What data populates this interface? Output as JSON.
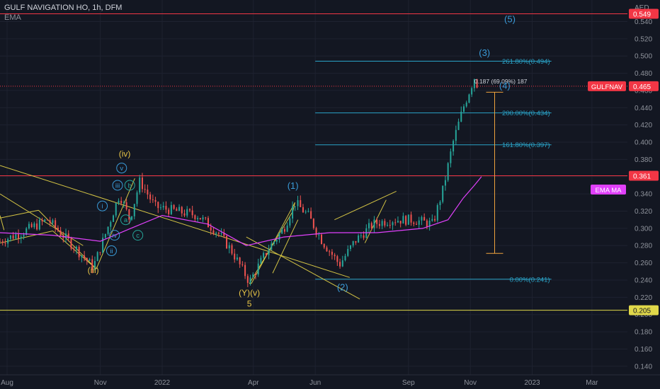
{
  "header": {
    "title": "GULF NAVIGATION HO, 1h, DFM",
    "indicator": "EMA"
  },
  "colors": {
    "background": "#131722",
    "grid": "#1e2230",
    "up": "#26a69a",
    "down": "#ef5350",
    "ema": "#e040fb",
    "trendline": "#d4c444",
    "fib": "#2aa3c7",
    "wave_blue": "#3a9bd8",
    "wave_yellow": "#e8c547",
    "measure": "#f0a33c",
    "red_line": "#f23645",
    "yellow_line": "#e0d84a"
  },
  "chart_data": {
    "type": "candlestick",
    "title": "GULF NAVIGATION HO, 1h, DFM",
    "currency": "AED",
    "ylim": [
      0.13,
      0.565
    ],
    "xlim": [
      "2021-07-25",
      "2023-04-05"
    ],
    "y_ticks": [
      "0.140",
      "0.160",
      "0.180",
      "0.200",
      "0.220",
      "0.240",
      "0.260",
      "0.280",
      "0.300",
      "0.320",
      "0.340",
      "0.360",
      "0.380",
      "0.400",
      "0.420",
      "0.440",
      "0.460",
      "0.480",
      "0.500",
      "0.520",
      "0.540"
    ],
    "x_ticks": [
      {
        "label": "Aug",
        "date": "2021-08-01"
      },
      {
        "label": "Nov",
        "date": "2021-11-01"
      },
      {
        "label": "2022",
        "date": "2022-01-01"
      },
      {
        "label": "Apr",
        "date": "2022-04-01"
      },
      {
        "label": "Jun",
        "date": "2022-06-01"
      },
      {
        "label": "Sep",
        "date": "2022-09-01"
      },
      {
        "label": "Nov",
        "date": "2022-11-01"
      },
      {
        "label": "2023",
        "date": "2023-01-01"
      },
      {
        "label": "Mar",
        "date": "2023-03-01"
      }
    ],
    "price_path": [
      [
        "2021-07-25",
        0.285
      ],
      [
        "2021-08-15",
        0.295
      ],
      [
        "2021-09-10",
        0.31
      ],
      [
        "2021-10-05",
        0.28
      ],
      [
        "2021-10-25",
        0.255
      ],
      [
        "2021-11-08",
        0.3
      ],
      [
        "2021-11-20",
        0.34
      ],
      [
        "2021-11-30",
        0.31
      ],
      [
        "2021-12-10",
        0.355
      ],
      [
        "2021-12-25",
        0.325
      ],
      [
        "2022-01-15",
        0.32
      ],
      [
        "2022-02-05",
        0.315
      ],
      [
        "2022-02-25",
        0.295
      ],
      [
        "2022-03-10",
        0.275
      ],
      [
        "2022-03-28",
        0.238
      ],
      [
        "2022-04-15",
        0.275
      ],
      [
        "2022-05-01",
        0.3
      ],
      [
        "2022-05-12",
        0.33
      ],
      [
        "2022-05-25",
        0.315
      ],
      [
        "2022-06-08",
        0.285
      ],
      [
        "2022-06-25",
        0.258
      ],
      [
        "2022-07-10",
        0.285
      ],
      [
        "2022-07-28",
        0.305
      ],
      [
        "2022-08-15",
        0.31
      ],
      [
        "2022-09-05",
        0.31
      ],
      [
        "2022-09-25",
        0.305
      ],
      [
        "2022-10-05",
        0.345
      ],
      [
        "2022-10-15",
        0.4
      ],
      [
        "2022-10-25",
        0.44
      ],
      [
        "2022-11-05",
        0.475
      ],
      [
        "2022-11-10",
        0.46
      ]
    ],
    "ema_path": [
      [
        "2021-07-25",
        0.295
      ],
      [
        "2021-09-15",
        0.292
      ],
      [
        "2021-11-01",
        0.285
      ],
      [
        "2021-12-01",
        0.3
      ],
      [
        "2022-01-01",
        0.315
      ],
      [
        "2022-02-15",
        0.305
      ],
      [
        "2022-03-25",
        0.28
      ],
      [
        "2022-05-01",
        0.29
      ],
      [
        "2022-06-15",
        0.295
      ],
      [
        "2022-08-01",
        0.295
      ],
      [
        "2022-09-15",
        0.3
      ],
      [
        "2022-10-10",
        0.31
      ],
      [
        "2022-10-25",
        0.335
      ],
      [
        "2022-11-05",
        0.35
      ],
      [
        "2022-11-12",
        0.36
      ]
    ],
    "fib_levels": [
      {
        "label": "261.80%(0.494)",
        "value": 0.494
      },
      {
        "label": "200.00%(0.434)",
        "value": 0.434
      },
      {
        "label": "161.80%(0.397)",
        "value": 0.397
      },
      {
        "label": "0.00%(0.241)",
        "value": 0.241
      }
    ],
    "fib_range": [
      "2022-06-01",
      "2023-01-20"
    ],
    "horizontal_lines": [
      {
        "value": 0.549,
        "label": "0.549",
        "color": "#f23645"
      },
      {
        "value": 0.465,
        "label": "0.465",
        "color": "#f23645",
        "dotted": true,
        "tag": "GULFNAV"
      },
      {
        "value": 0.361,
        "label": "0.361",
        "color": "#f23645",
        "tag": "EMA MA"
      },
      {
        "value": 0.205,
        "label": "0.205",
        "color": "#e0d84a"
      }
    ],
    "measure": {
      "date": "2022-11-25",
      "from": 0.271,
      "to": 0.458,
      "label": "0.187 (69.09%) 187"
    },
    "wave_labels": [
      {
        "text": "(5)",
        "date": "2022-12-10",
        "value": 0.539,
        "color": "#3a9bd8",
        "size": 13
      },
      {
        "text": "(3)",
        "date": "2022-11-15",
        "value": 0.5,
        "color": "#3a9bd8",
        "size": 13
      },
      {
        "text": "(4)",
        "date": "2022-12-05",
        "value": 0.462,
        "color": "#3a9bd8",
        "size": 13
      },
      {
        "text": "(1)",
        "date": "2022-05-10",
        "value": 0.346,
        "color": "#3a9bd8",
        "size": 13
      },
      {
        "text": "(2)",
        "date": "2022-06-28",
        "value": 0.228,
        "color": "#3a9bd8",
        "size": 13
      },
      {
        "text": "(iv)",
        "date": "2021-11-25",
        "value": 0.383,
        "color": "#e8c547",
        "size": 12
      },
      {
        "text": "(iii)",
        "date": "2021-10-25",
        "value": 0.248,
        "color": "#e8c547",
        "size": 12
      },
      {
        "text": "(Y)(v)",
        "date": "2022-03-28",
        "value": 0.222,
        "color": "#e8c547",
        "size": 12
      },
      {
        "text": "5",
        "date": "2022-03-28",
        "value": 0.209,
        "color": "#e8c547",
        "size": 12
      }
    ],
    "circled_labels": [
      {
        "text": "v",
        "date": "2021-11-22",
        "value": 0.37,
        "color": "#3a9bd8"
      },
      {
        "text": "iii",
        "date": "2021-11-18",
        "value": 0.35,
        "color": "#3a9bd8"
      },
      {
        "text": "b",
        "date": "2021-11-30",
        "value": 0.35,
        "color": "#26a69a"
      },
      {
        "text": "i",
        "date": "2021-11-03",
        "value": 0.326,
        "color": "#3a9bd8"
      },
      {
        "text": "a",
        "date": "2021-11-26",
        "value": 0.31,
        "color": "#26a69a"
      },
      {
        "text": "iv",
        "date": "2021-11-15",
        "value": 0.292,
        "color": "#3a9bd8"
      },
      {
        "text": "c",
        "date": "2021-12-08",
        "value": 0.292,
        "color": "#26a69a"
      },
      {
        "text": "ii",
        "date": "2021-11-12",
        "value": 0.274,
        "color": "#3a9bd8"
      }
    ],
    "trendlines": [
      [
        [
          "2021-07-25",
          0.373
        ],
        [
          "2022-07-05",
          0.243
        ]
      ],
      [
        [
          "2021-07-25",
          0.34
        ],
        [
          "2021-10-15",
          0.28
        ]
      ],
      [
        [
          "2021-07-25",
          0.312
        ],
        [
          "2021-09-01",
          0.321
        ]
      ],
      [
        [
          "2021-07-25",
          0.283
        ],
        [
          "2021-09-15",
          0.297
        ]
      ],
      [
        [
          "2021-09-01",
          0.321
        ],
        [
          "2021-10-28",
          0.253
        ]
      ],
      [
        [
          "2021-09-15",
          0.297
        ],
        [
          "2021-10-28",
          0.253
        ]
      ],
      [
        [
          "2021-10-28",
          0.253
        ],
        [
          "2021-12-05",
          0.358
        ]
      ],
      [
        [
          "2021-07-25",
          0.315
        ],
        [
          "2021-07-29",
          0.298
        ]
      ],
      [
        [
          "2022-03-28",
          0.236
        ],
        [
          "2022-05-10",
          0.32
        ]
      ],
      [
        [
          "2022-03-30",
          0.236
        ],
        [
          "2022-05-12",
          0.33
        ]
      ],
      [
        [
          "2022-05-10",
          0.32
        ],
        [
          "2022-05-12",
          0.33
        ]
      ],
      [
        [
          "2022-03-28",
          0.236
        ],
        [
          "2022-03-30",
          0.236
        ]
      ],
      [
        [
          "2022-03-25",
          0.29
        ],
        [
          "2022-07-15",
          0.218
        ]
      ],
      [
        [
          "2022-06-20",
          0.31
        ],
        [
          "2022-08-20",
          0.343
        ]
      ],
      [
        [
          "2022-07-20",
          0.283
        ],
        [
          "2022-08-10",
          0.333
        ]
      ],
      [
        [
          "2022-04-20",
          0.248
        ],
        [
          "2022-05-15",
          0.31
        ]
      ]
    ],
    "last_price_tag": {
      "text": "GULFNAV",
      "value": 0.465
    }
  }
}
